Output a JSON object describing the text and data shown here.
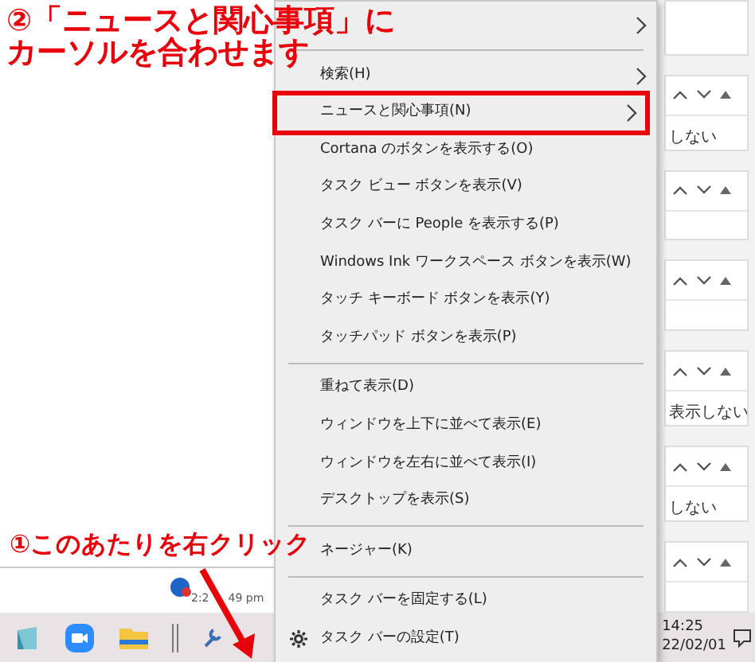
{
  "annotations": [
    {
      "kind": "step-two",
      "lines": [
        "②「ニュースと関心事項」に",
        "カーソルを合わせます"
      ]
    },
    {
      "kind": "step-one",
      "lines": [
        "①このあたりを右クリック"
      ]
    }
  ],
  "context_menu": {
    "items": [
      {
        "kind": "item",
        "has_submenu": true,
        "selected": false
      },
      {
        "kind": "separator"
      },
      {
        "kind": "item",
        "label": "検索(H)",
        "has_submenu": true,
        "selected": false
      },
      {
        "kind": "item",
        "label": "ニュースと関心事項(N)",
        "has_submenu": true,
        "selected": true
      },
      {
        "kind": "item",
        "label": "Cortana のボタンを表示する(O)",
        "selected": false
      },
      {
        "kind": "item",
        "label": "タスク ビュー ボタンを表示(V)",
        "selected": false
      },
      {
        "kind": "item",
        "label": "タスク バーに People を表示する(P)",
        "selected": false
      },
      {
        "kind": "item",
        "label": "Windows Ink ワークスペース ボタンを表示(W)",
        "selected": false
      },
      {
        "kind": "item",
        "label": "タッチ キーボード ボタンを表示(Y)",
        "selected": false
      },
      {
        "kind": "item",
        "label": "タッチパッド ボタンを表示(P)",
        "selected": false
      },
      {
        "kind": "separator"
      },
      {
        "kind": "item",
        "label": "重ねて表示(D)",
        "selected": false
      },
      {
        "kind": "item",
        "label": "ウィンドウを上下に並べて表示(E)",
        "selected": false
      },
      {
        "kind": "item",
        "label": "ウィンドウを左右に並べて表示(I)",
        "selected": false
      },
      {
        "kind": "item",
        "label": "デスクトップを表示(S)",
        "selected": false
      },
      {
        "kind": "separator"
      },
      {
        "kind": "item",
        "label": "ネージャー(K)",
        "selected": false
      },
      {
        "kind": "separator"
      },
      {
        "kind": "item",
        "label": "タスク バーを固定する(L)",
        "selected": false
      },
      {
        "kind": "settings",
        "label": "タスク バーの設定(T)",
        "selected": false
      }
    ]
  },
  "background_window": {
    "timestamp": [
      "2:2",
      "49 pm"
    ],
    "panels": [
      {
        "kind": "text",
        "text": "しない"
      },
      {
        "kind": "blank"
      },
      {
        "kind": "blank"
      },
      {
        "kind": "text",
        "text": "表示しない"
      },
      {
        "kind": "text",
        "text": "しない"
      },
      {
        "kind": "blank"
      }
    ]
  },
  "taskbar": {
    "clock": {
      "time": "14:25",
      "date": "22/02/01"
    }
  }
}
